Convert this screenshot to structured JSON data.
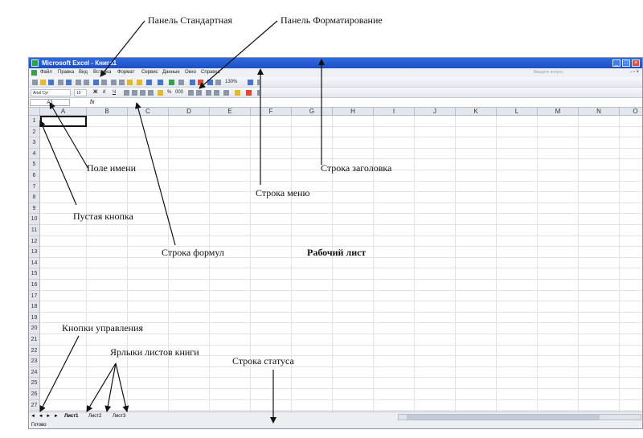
{
  "window": {
    "title": "Microsoft Excel - Книга1",
    "controls": [
      "_",
      "□",
      "×"
    ]
  },
  "menu": {
    "items": [
      "Файл",
      "Правка",
      "Вид",
      "Вставка",
      "Формат",
      "Сервис",
      "Данные",
      "Окно",
      "Справка"
    ],
    "ask_placeholder": "Введите вопрос",
    "doc_controls": "- ▫ ×"
  },
  "toolbar": {
    "zoom": "130%",
    "font_name": "Arial Cyr",
    "font_size": "10",
    "bold": "Ж",
    "italic": "К",
    "underline": "Ч",
    "percent": "%",
    "thousands": "000"
  },
  "formula_bar": {
    "name_box": "A1",
    "fx": "fx"
  },
  "sheet": {
    "columns": [
      "A",
      "B",
      "C",
      "D",
      "E",
      "F",
      "G",
      "H",
      "I",
      "J",
      "K",
      "L",
      "M",
      "N",
      "O"
    ],
    "rows": [
      "1",
      "2",
      "3",
      "4",
      "5",
      "6",
      "7",
      "8",
      "9",
      "10",
      "11",
      "12",
      "13",
      "14",
      "15",
      "16",
      "17",
      "18",
      "19",
      "20",
      "21",
      "22",
      "23",
      "24",
      "25",
      "26",
      "27"
    ],
    "nav_buttons": "◄ ◄ ► ►",
    "tabs": [
      "Лист1",
      "Лист2",
      "Лист3"
    ]
  },
  "status": {
    "text": "Готово"
  },
  "annotations": {
    "standard_panel": "Панель Стандартная",
    "formatting_panel": "Панель Форматирование",
    "name_field": "Поле имени",
    "title_bar": "Строка заголовка",
    "menu_bar": "Строка меню",
    "empty_button": "Пустая кнопка",
    "formula_bar": "Строка формул",
    "worksheet": "Рабочий лист",
    "control_buttons": "Кнопки управления",
    "sheet_tabs": "Ярлыки листов книги",
    "status_bar": "Строка статуса"
  }
}
